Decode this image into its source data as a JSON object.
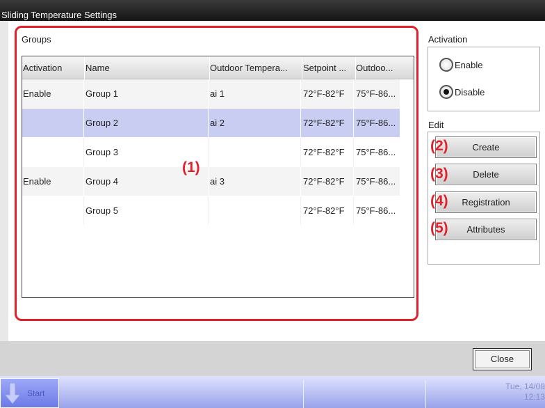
{
  "window": {
    "title": "Sliding Temperature Settings"
  },
  "groups": {
    "label": "Groups",
    "columns": [
      "Activation",
      "Name",
      "Outdoor Tempera...",
      "Setpoint ...",
      "Outdoo..."
    ],
    "rows": [
      {
        "activation": "Enable",
        "name": "Group 1",
        "outdoor": "ai 1",
        "setpoint": "72°F-82°F",
        "outdoor_range": "75°F-86..."
      },
      {
        "activation": "",
        "name": "Group 2",
        "outdoor": "ai 2",
        "setpoint": "72°F-82°F",
        "outdoor_range": "75°F-86...",
        "selected": true
      },
      {
        "activation": "",
        "name": "Group 3",
        "outdoor": "",
        "setpoint": "72°F-82°F",
        "outdoor_range": "75°F-86..."
      },
      {
        "activation": "Enable",
        "name": "Group 4",
        "outdoor": "ai 3",
        "setpoint": "72°F-82°F",
        "outdoor_range": "75°F-86..."
      },
      {
        "activation": "",
        "name": "Group 5",
        "outdoor": "",
        "setpoint": "72°F-82°F",
        "outdoor_range": "75°F-86..."
      }
    ]
  },
  "activation": {
    "label": "Activation",
    "enable": "Enable",
    "disable": "Disable",
    "selected": "Disable"
  },
  "edit": {
    "label": "Edit",
    "create": "Create",
    "delete": "Delete",
    "registration": "Registration",
    "attributes": "Attributes"
  },
  "callouts": {
    "c1": "(1)",
    "c2": "(2)",
    "c3": "(3)",
    "c4": "(4)",
    "c5": "(5)"
  },
  "footer": {
    "close": "Close"
  },
  "taskbar": {
    "start": "Start",
    "date": "Tue, 14/08",
    "time": "12:13"
  },
  "colors": {
    "accent_red": "#e0202a",
    "selected_row": "#c9cdf1",
    "taskbar": "#9aa3ea"
  },
  "icons": {
    "start": "arrow-down-icon",
    "radio": "radio-icon"
  }
}
